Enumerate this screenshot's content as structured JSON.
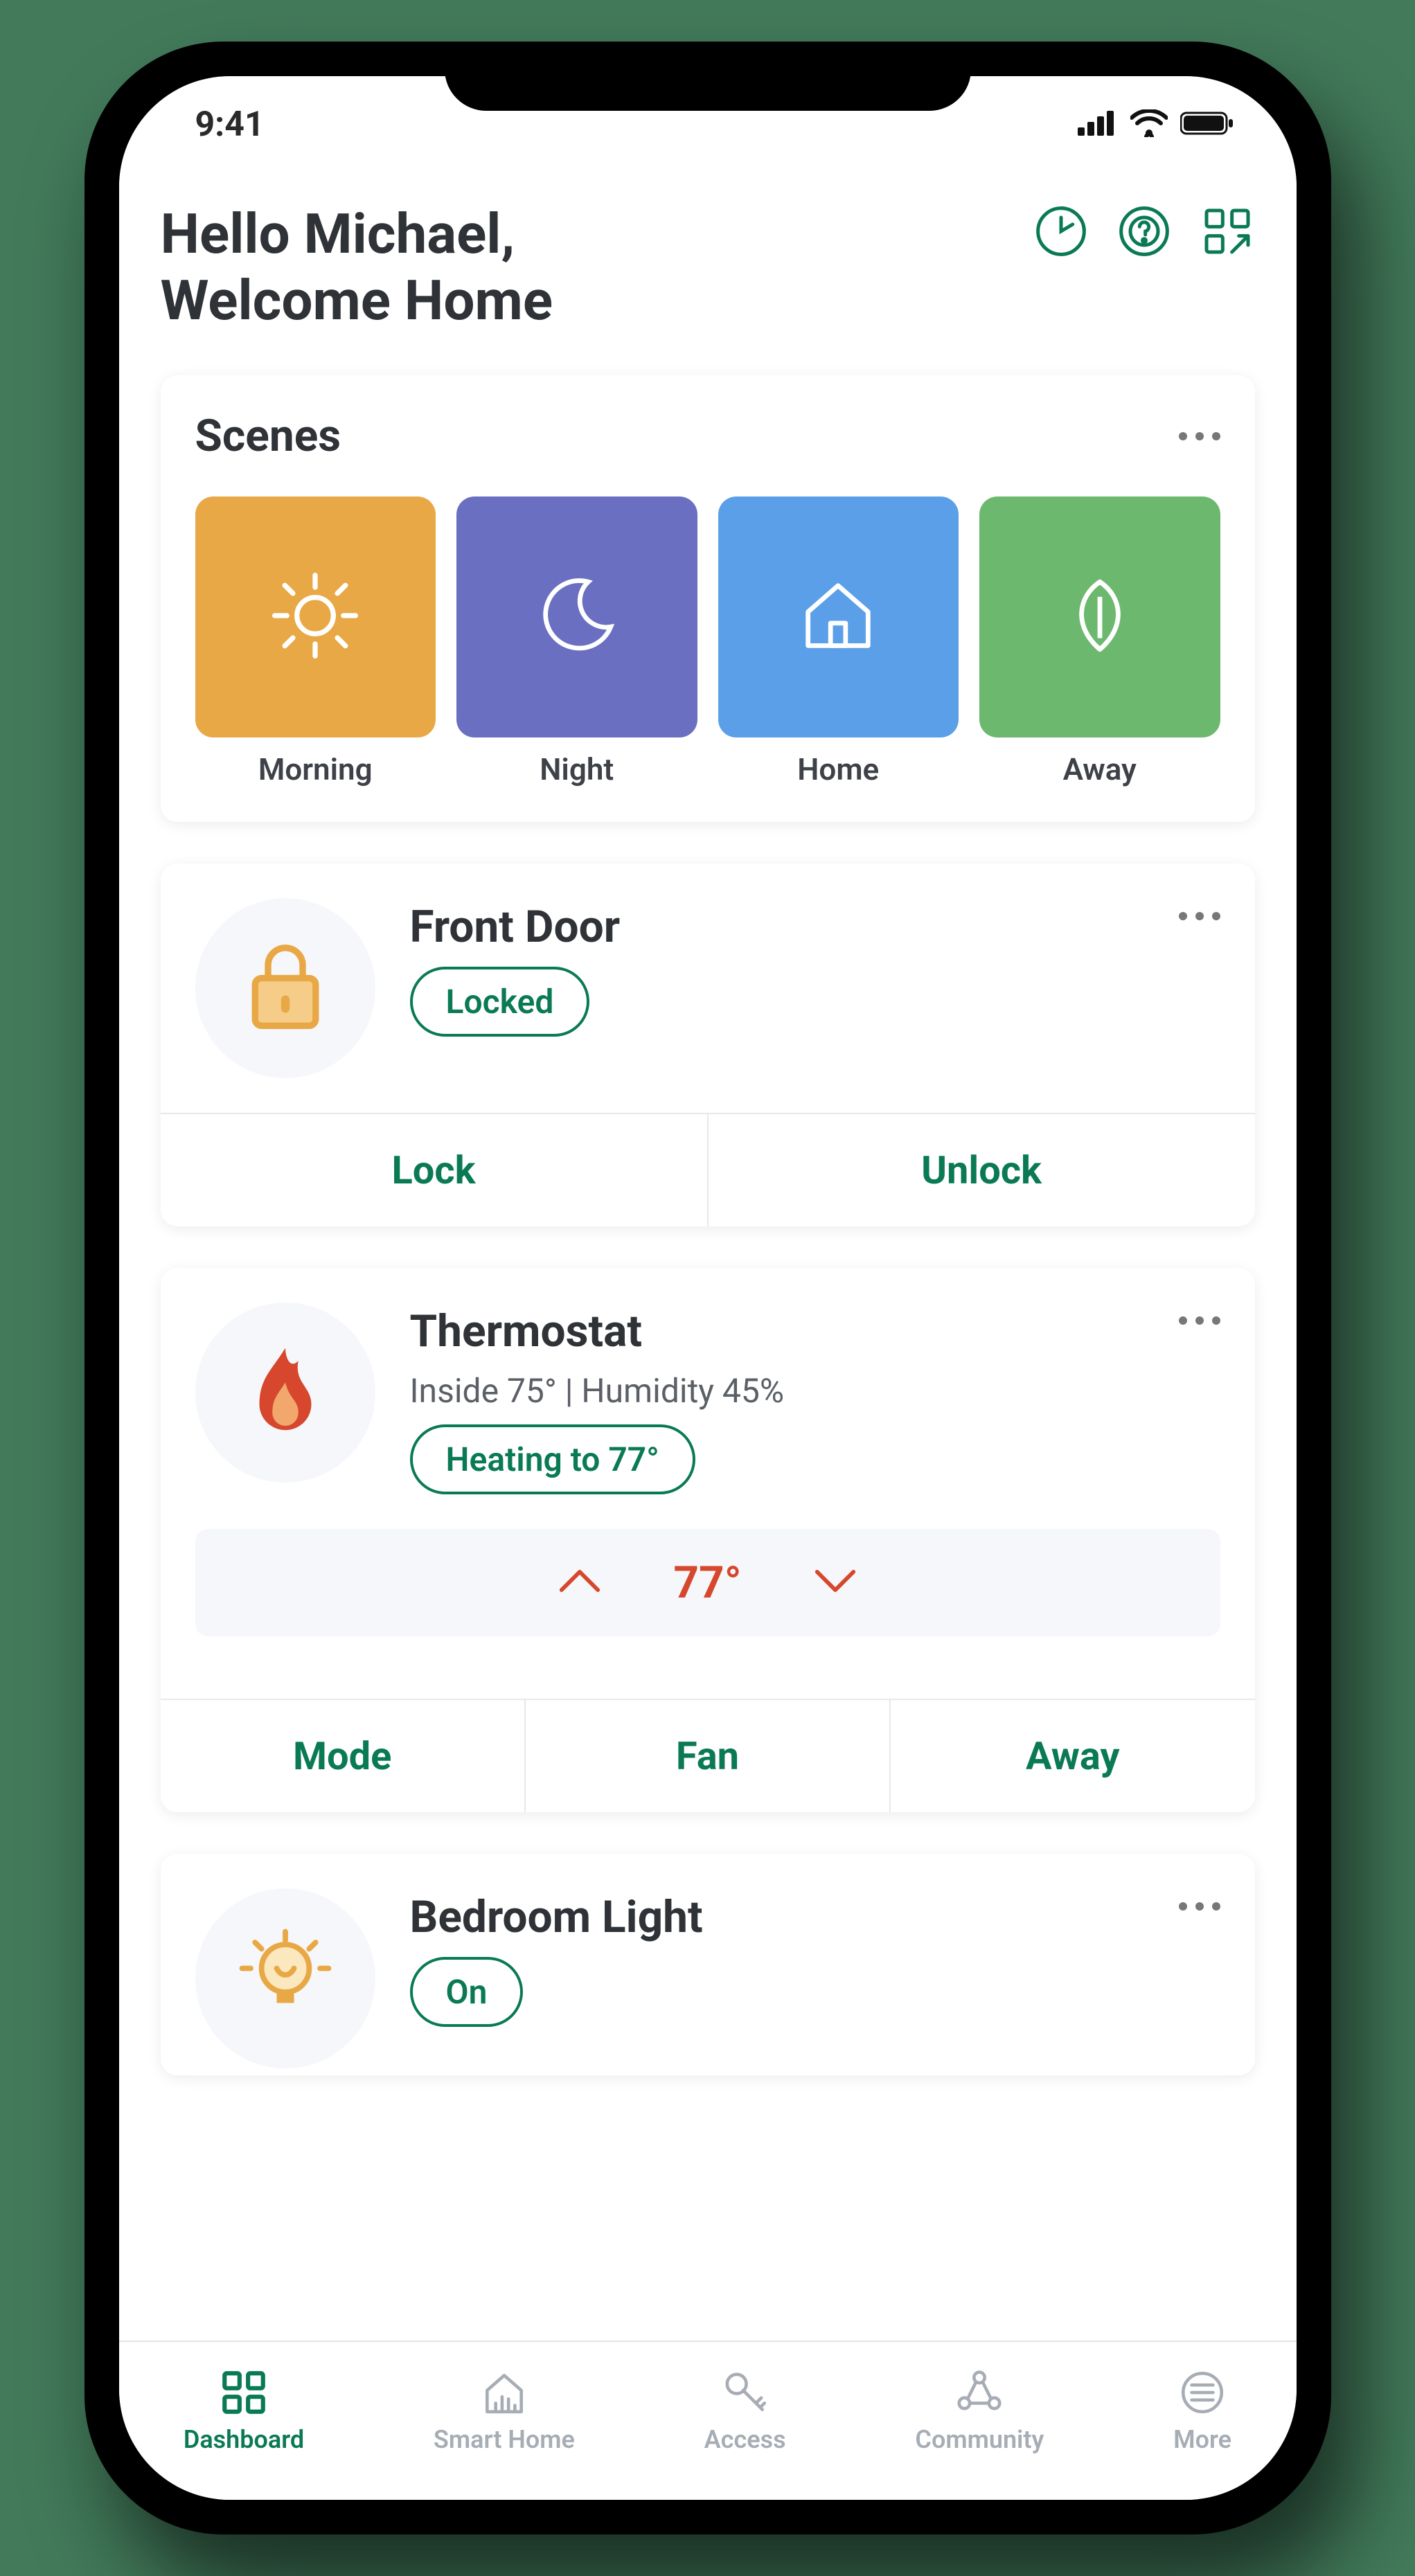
{
  "status": {
    "time": "9:41"
  },
  "greeting": {
    "line1": "Hello Michael,",
    "line2": "Welcome Home"
  },
  "scenes": {
    "title": "Scenes",
    "items": [
      {
        "label": "Morning",
        "color": "#e9a846"
      },
      {
        "label": "Night",
        "color": "#6a6fc1"
      },
      {
        "label": "Home",
        "color": "#5a9fe8"
      },
      {
        "label": "Away",
        "color": "#6db86f"
      }
    ]
  },
  "frontDoor": {
    "title": "Front Door",
    "status": "Locked",
    "actions": {
      "lock": "Lock",
      "unlock": "Unlock"
    }
  },
  "thermostat": {
    "title": "Thermostat",
    "sub": "Inside 75° | Humidity 45%",
    "status": "Heating to 77°",
    "setpoint": "77°",
    "actions": {
      "mode": "Mode",
      "fan": "Fan",
      "away": "Away"
    }
  },
  "light": {
    "title": "Bedroom Light",
    "status": "On"
  },
  "tabs": [
    {
      "label": "Dashboard"
    },
    {
      "label": "Smart Home"
    },
    {
      "label": "Access"
    },
    {
      "label": "Community"
    },
    {
      "label": "More"
    }
  ]
}
